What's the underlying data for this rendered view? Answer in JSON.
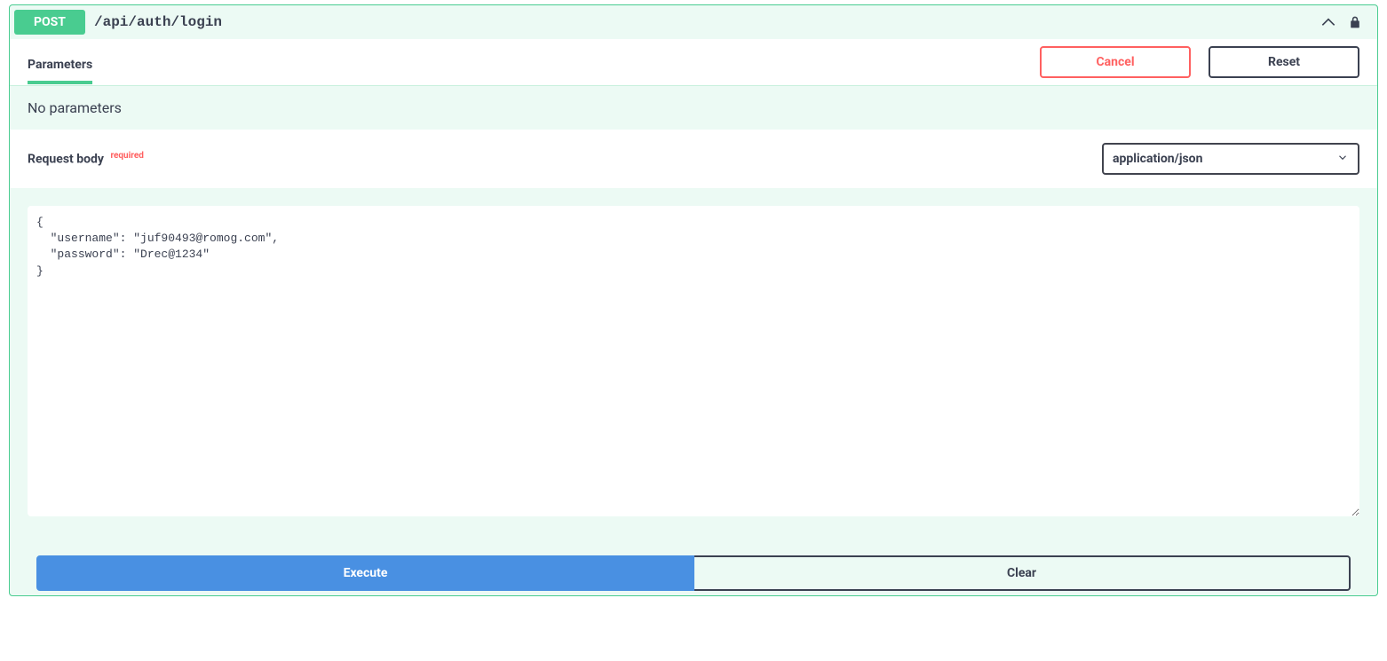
{
  "header": {
    "method": "POST",
    "path": "/api/auth/login"
  },
  "tabs": {
    "parameters_label": "Parameters",
    "cancel_label": "Cancel",
    "reset_label": "Reset"
  },
  "parameters": {
    "none_text": "No parameters"
  },
  "request_body": {
    "title": "Request body",
    "required_label": "required",
    "content_type": "application/json",
    "body_text": "{\n  \"username\": \"juf90493@romog.com\",\n  \"password\": \"Drec@1234\"\n}"
  },
  "actions": {
    "execute_label": "Execute",
    "clear_label": "Clear"
  }
}
